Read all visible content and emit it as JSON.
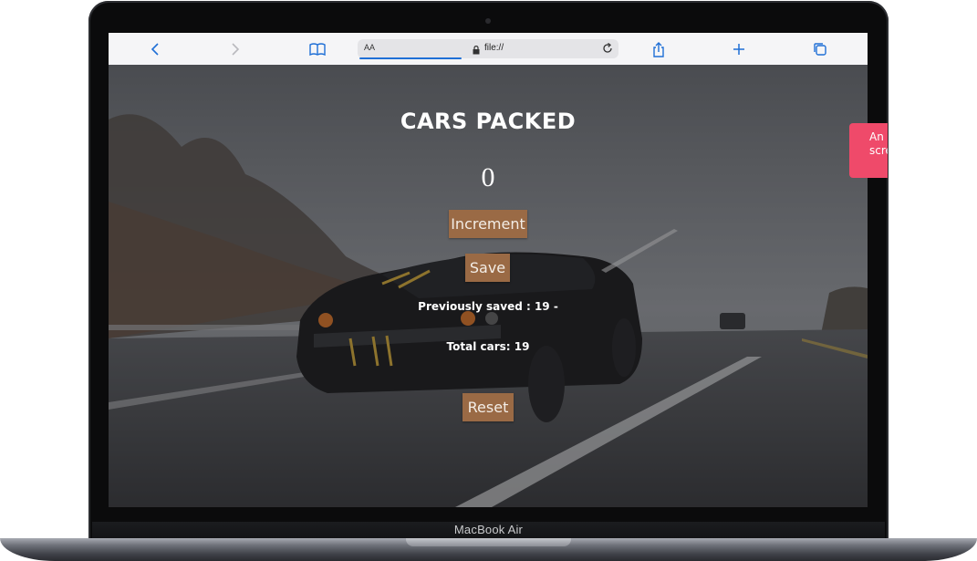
{
  "device": {
    "label": "MacBook Air"
  },
  "browser": {
    "address_aa": "AA",
    "address_url": "file://",
    "icons": [
      "back-icon",
      "forward-icon",
      "bookmarks-icon",
      "lock-icon",
      "reload-icon",
      "share-icon",
      "new-tab-icon",
      "tabs-icon"
    ]
  },
  "app": {
    "title": "CARS PACKED",
    "count": "0",
    "increment_label": "Increment",
    "save_label": "Save",
    "previously_saved": "Previously saved : 19 -",
    "total_cars": "Total cars: 19",
    "reset_label": "Reset"
  },
  "toast": {
    "line1": "An",
    "line2": "scre"
  },
  "colors": {
    "button_bg": "#9a6a45",
    "toast_bg": "#ef4a6a",
    "accent": "#1f6fd6"
  }
}
